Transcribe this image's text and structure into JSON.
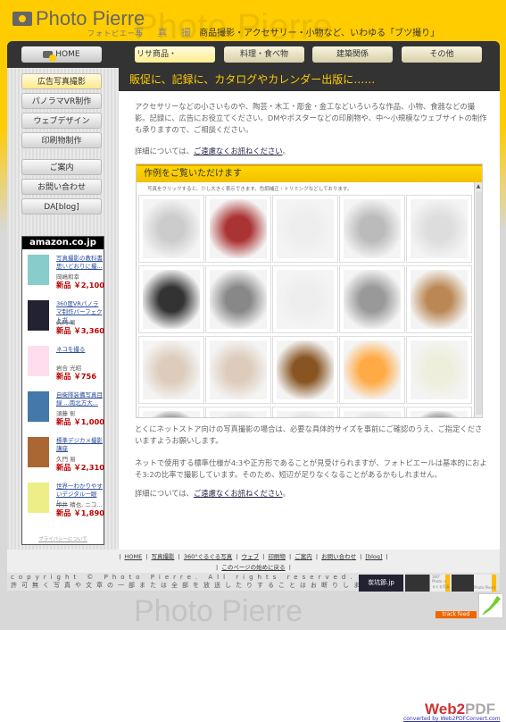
{
  "header": {
    "logo": "Photo Pierre",
    "logo_sub": "フォトピエール",
    "tagline_label": "写 真 撮",
    "tagline": "商品撮影・アクセサリー・小物など、いわゆる「ブツ撮り」",
    "watermark": "Photo Pierre"
  },
  "nav": [
    {
      "label": "HOME",
      "icon": "camera-icon"
    },
    {
      "label": "リサ商品・"
    },
    {
      "label": "料理・食べ物"
    },
    {
      "label": "建築関係"
    },
    {
      "label": "その他"
    }
  ],
  "sidebar": {
    "items": [
      "広告写真撮影",
      "パノラマVR制作",
      "ウェブデザイン",
      "印刷物制作",
      "ご案内",
      "お問い合わせ",
      "DA[blog]"
    ],
    "active": 0
  },
  "amazon": {
    "title": "amazon.co.jp",
    "privacy": "プライバシーについて",
    "books": [
      {
        "title": "写真撮影の教科書 思いどおりに撮...",
        "author": "岡嶋和幸",
        "price": "新品 ￥2,100"
      },
      {
        "title": "360度VRパノラマ制作パーフェクトガ...",
        "author": "久門 易",
        "price": "新品 ￥3,360"
      },
      {
        "title": "ネコを撮る",
        "author": "岩合 光昭",
        "price": "新品 ￥756"
      },
      {
        "title": "自衛隊装備写真目録 ...南北方大...",
        "author": "須藤 彰",
        "price": "新品 ￥1,000"
      },
      {
        "title": "標準デジカメ撮影講座",
        "author": "久門 易",
        "price": "新品 ￥2,310"
      },
      {
        "title": "世界一わかりやすいデジタル一眼レ...",
        "author": "中井 精也, ニコ...",
        "price": "新品 ￥1,890"
      }
    ]
  },
  "main": {
    "heading": "販促に、記録に、カタログやカレンダー出版に……",
    "intro": "アクセサリーなどの小さいものや、陶芸・木工・彫金・金工などいろいろな作品、小物、食器などの撮影。記録に、広告にお役立てください。DMやポスターなどの印刷物や、中～小規模なウェブサイトの制作も承りますので、ご相談ください。",
    "detail_prefix": "詳細については、",
    "detail_link": "ご遠慮なくお訊ねください",
    "detail_suffix": "。",
    "gallery_title": "作例をご覧いただけます",
    "gallery_caption": "写真をクリックすると、少し大きく表示できます。色調補正・トリミングなどしております。",
    "para2": "とくにネットストア向けの写真撮影の場合は、必要な具体的サイズを事前にご確認のうえ、ご指定くださいますようお願いします。",
    "para3": "ネットで使用する標準仕様が4:3や正方形であることが見受けられますが、フォトピエールは基本的におよそ3:2の比率で撮影しています。そのため、短辺が足りなくなることがあるかもしれません。"
  },
  "footer": {
    "links": [
      "HOME",
      "写真撮影",
      "360°ぐるぐる写真",
      "ウェブ",
      "印刷物",
      "ご案内",
      "お問い合わせ",
      "[blog]"
    ],
    "top_link": "このページの始めに戻る",
    "copyright": "copyright © Photo Pierre. All rights reserved.",
    "notice": "許可無く写真や文章の一部または全部を放送したりすることはお断りします。",
    "banners": [
      "炭坑節.jp",
      "360° Photo ぐるぐる写真",
      "Photo Pierre"
    ],
    "trackfeed": "track feed"
  },
  "web2pdf": {
    "logo": "Web2PDF",
    "link": "converted by Web2PDFConvert.com"
  }
}
